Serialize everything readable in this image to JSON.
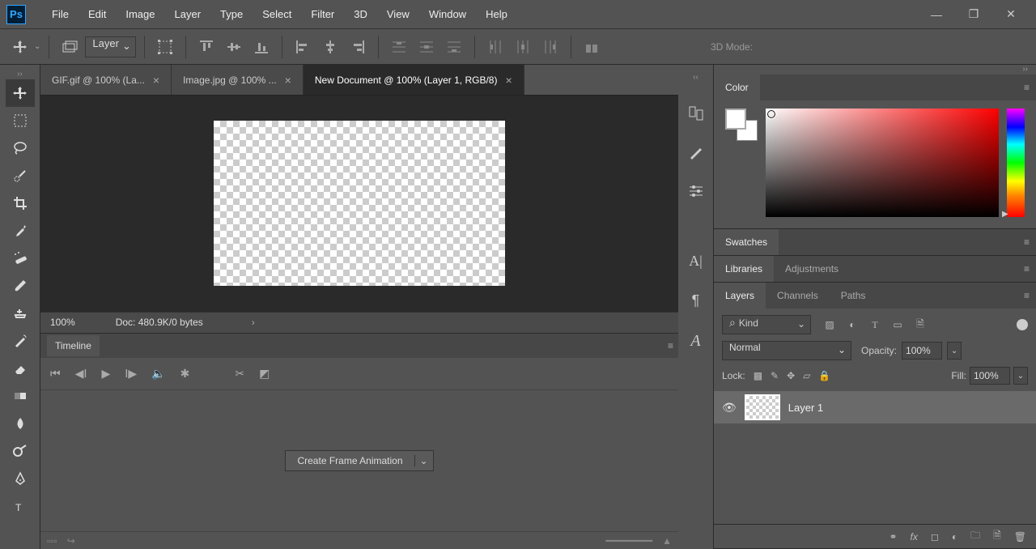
{
  "app": {
    "logo": "Ps"
  },
  "menu": [
    "File",
    "Edit",
    "Image",
    "Layer",
    "Type",
    "Select",
    "Filter",
    "3D",
    "View",
    "Window",
    "Help"
  ],
  "options_bar": {
    "layer_target": "Layer",
    "mode3d_label": "3D Mode:"
  },
  "tabs": [
    {
      "label": "GIF.gif @ 100% (La...",
      "active": false
    },
    {
      "label": "Image.jpg @ 100% ...",
      "active": false
    },
    {
      "label": "New Document @ 100% (Layer 1, RGB/8)",
      "active": true
    }
  ],
  "status": {
    "zoom": "100%",
    "doc": "Doc: 480.9K/0 bytes"
  },
  "timeline": {
    "title": "Timeline",
    "create_button": "Create Frame Animation"
  },
  "panels": {
    "color": "Color",
    "swatches": "Swatches",
    "libraries": "Libraries",
    "adjustments": "Adjustments",
    "layers": "Layers",
    "channels": "Channels",
    "paths": "Paths"
  },
  "layers_panel": {
    "kind": "Kind",
    "blend_mode": "Normal",
    "opacity_label": "Opacity:",
    "opacity_value": "100%",
    "lock_label": "Lock:",
    "fill_label": "Fill:",
    "fill_value": "100%",
    "layer1_name": "Layer 1"
  }
}
